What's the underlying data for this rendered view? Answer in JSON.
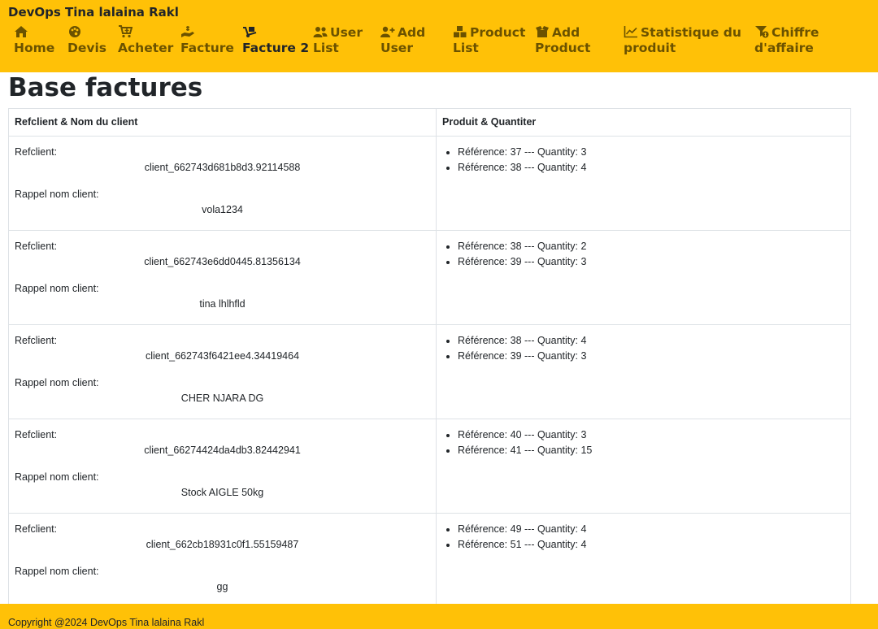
{
  "header": {
    "brand": "DevOps Tina lalaina Rakl",
    "nav": [
      {
        "label": "Home",
        "icon": "home-icon",
        "active": false
      },
      {
        "label": "Devis",
        "icon": "palette-icon",
        "active": false
      },
      {
        "label": "Acheter",
        "icon": "cart-plus-icon",
        "active": false
      },
      {
        "label": "Facture",
        "icon": "hand-holding-dollar-icon",
        "active": false
      },
      {
        "label": "Facture 2",
        "icon": "dolly-icon",
        "active": true
      },
      {
        "label": "User\nList",
        "icon": "users-icon",
        "active": false
      },
      {
        "label": "Add\nUser",
        "icon": "user-plus-icon",
        "active": false
      },
      {
        "label": "Product\nList",
        "icon": "boxes-icon",
        "active": false
      },
      {
        "label": "Add\nProduct",
        "icon": "box-open-icon",
        "active": false
      },
      {
        "label": "Statistique du\nproduit",
        "icon": "chart-line-icon",
        "active": false
      },
      {
        "label": "Chiffre\nd'affaire",
        "icon": "filter-dollar-icon",
        "active": false
      }
    ],
    "colors": {
      "bar": "#ffc107",
      "nav_text": "#6b5200",
      "active_text": "#212529"
    }
  },
  "main": {
    "title": "Base factures",
    "columns": [
      "Refclient & Nom du client",
      "Produit & Quantiter"
    ],
    "labels": {
      "refclient": "Refclient:",
      "rappel": "Rappel nom client:"
    },
    "rows": [
      {
        "refclient": "client_662743d681b8d3.92114588",
        "nom": "vola1234",
        "produits": [
          "Référence: 37 --- Quantity: 3",
          "Référence: 38 --- Quantity: 4"
        ]
      },
      {
        "refclient": "client_662743e6dd0445.81356134",
        "nom": "tina lhlhfld",
        "produits": [
          "Référence: 38 --- Quantity: 2",
          "Référence: 39 --- Quantity: 3"
        ]
      },
      {
        "refclient": "client_662743f6421ee4.34419464",
        "nom": "CHER NJARA DG",
        "produits": [
          "Référence: 38 --- Quantity: 4",
          "Référence: 39 --- Quantity: 3"
        ]
      },
      {
        "refclient": "client_66274424da4db3.82442941",
        "nom": "Stock AIGLE 50kg",
        "produits": [
          "Référence: 40 --- Quantity: 3",
          "Référence: 41 --- Quantity: 15"
        ]
      },
      {
        "refclient": "client_662cb18931c0f1.55159487",
        "nom": "gg",
        "produits": [
          "Référence: 49 --- Quantity: 4",
          "Référence: 51 --- Quantity: 4"
        ]
      }
    ]
  },
  "footer": {
    "text": "Copyright @2024 DevOps Tina lalaina Rakl"
  }
}
